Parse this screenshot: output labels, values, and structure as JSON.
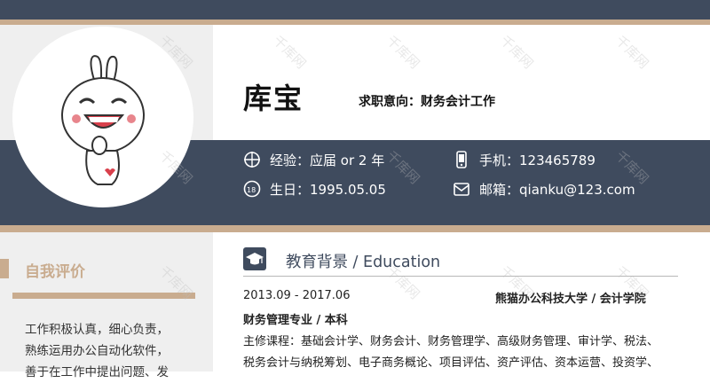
{
  "header": {
    "name": "库宝",
    "job_intent": "求职意向：财务会计工作"
  },
  "info": {
    "experience": "经验：应届  or 2 年",
    "phone": "手机：123465789",
    "birthday": "生日：1995.05.05",
    "email": "邮箱：qianku@123.com"
  },
  "self_eval": {
    "title": "自我评价",
    "lines": [
      "工作积极认真，细心负责，",
      "熟练运用办公自动化软件，",
      "善于在工作中提出问题、发"
    ]
  },
  "education": {
    "title": "教育背景  /  Education",
    "period": "2013.09  -  2017.06",
    "school": "熊猫办公科技大学  /  会计学院",
    "major": "财务管理专业  /  本科",
    "courses_1": "主修课程：基础会计学、财务会计、财务管理学、高级财务管理、审计学、税法、",
    "courses_2": "税务会计与纳税筹划、电子商务概论、项目评估、资产评估、资本运营、投资学、"
  },
  "watermark": "千库网",
  "colors": {
    "navy": "#3f4b5e",
    "tan": "#c9ac8f",
    "light_gray": "#efefef"
  },
  "icons": [
    "target-icon",
    "18-plus-icon",
    "phone-icon",
    "mail-icon",
    "graduation-cap-icon"
  ]
}
